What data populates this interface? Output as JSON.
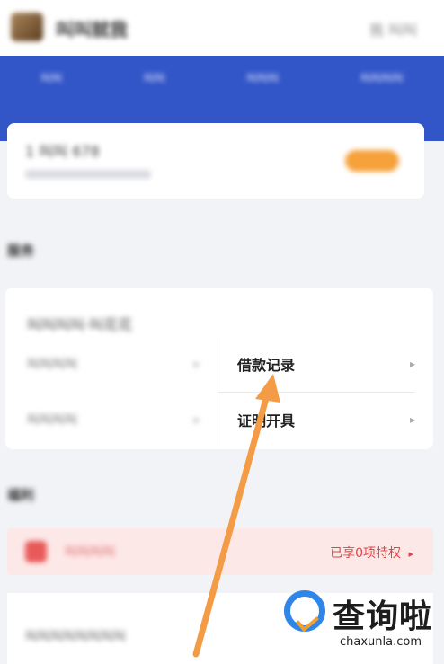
{
  "header": {
    "app_title": "叫叫就我",
    "top_right_label": "我 叫叫"
  },
  "blue_nav": {
    "items": [
      "叫叫",
      "叫叫",
      "叫叫叫",
      "叫叫叫叫"
    ]
  },
  "account_card": {
    "line1": "1 叫叫 678"
  },
  "sections": {
    "services_title": "服务",
    "benefits_title": "福利"
  },
  "services": {
    "header": "叫叫叫叫·叫花花",
    "left_top": "叫叫叫叫",
    "left_bottom": "叫叫叫叫",
    "loan_record": "借款记录",
    "certificate": "证明开具",
    "chevron": "▸"
  },
  "benefits": {
    "pink_label": "叫叫叫叫",
    "privilege_text": "已享0项特权",
    "bottom_label": "叫叫叫叫叫叫叫叫"
  },
  "watermark": {
    "title": "查询啦",
    "url": "chaxunla.com"
  },
  "colors": {
    "accent_blue": "#3255c8",
    "arrow_orange": "#f39b45",
    "privilege_red": "#e04545",
    "orange_button": "#f6a13a"
  }
}
